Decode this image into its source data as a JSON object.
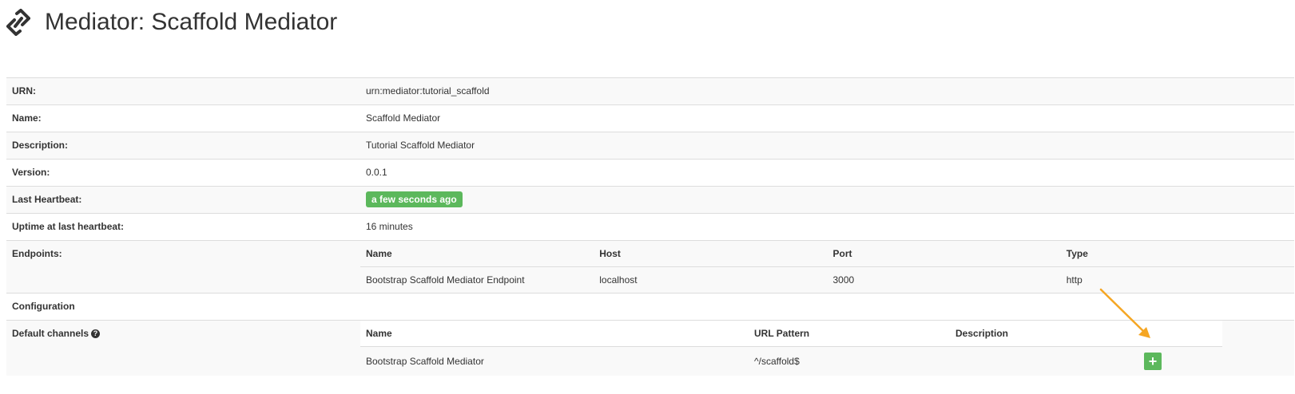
{
  "page": {
    "title": "Mediator: Scaffold Mediator"
  },
  "details": {
    "urn": {
      "label": "URN:",
      "value": "urn:mediator:tutorial_scaffold"
    },
    "name": {
      "label": "Name:",
      "value": "Scaffold Mediator"
    },
    "description": {
      "label": "Description:",
      "value": "Tutorial Scaffold Mediator"
    },
    "version": {
      "label": "Version:",
      "value": "0.0.1"
    },
    "last_heartbeat": {
      "label": "Last Heartbeat:",
      "value": "a few seconds ago",
      "badge_color": "#5cb85c"
    },
    "uptime": {
      "label": "Uptime at last heartbeat:",
      "value": "16 minutes"
    }
  },
  "endpoints": {
    "label": "Endpoints:",
    "columns": [
      "Name",
      "Host",
      "Port",
      "Type"
    ],
    "rows": [
      [
        "Bootstrap Scaffold Mediator Endpoint",
        "localhost",
        "3000",
        "http"
      ]
    ]
  },
  "configuration": {
    "label": "Configuration"
  },
  "default_channels": {
    "label": "Default channels",
    "help_icon": "question-circle-icon",
    "columns": [
      "Name",
      "URL Pattern",
      "Description"
    ],
    "rows": [
      {
        "name": "Bootstrap Scaffold Mediator",
        "url_pattern": "^/scaffold$",
        "description": "",
        "action_icon": "plus-icon"
      }
    ]
  },
  "colors": {
    "accent_green": "#5cb85c",
    "annotation_arrow": "#f5a623"
  },
  "icons": {
    "title_icon": "link-icon"
  }
}
